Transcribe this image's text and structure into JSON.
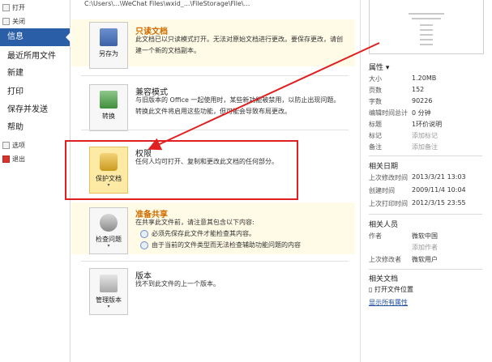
{
  "nav": {
    "small_top": [
      {
        "label": "打开",
        "icon": "folder-open-icon"
      },
      {
        "label": "关闭",
        "icon": "close-document-icon"
      }
    ],
    "items": [
      {
        "label": "信息",
        "active": true
      },
      {
        "label": "最近所用文件",
        "active": false
      },
      {
        "label": "新建",
        "active": false
      },
      {
        "label": "打印",
        "active": false
      },
      {
        "label": "保存并发送",
        "active": false
      },
      {
        "label": "帮助",
        "active": false
      }
    ],
    "small_bottom": [
      {
        "label": "选项",
        "icon": "options-icon"
      },
      {
        "label": "退出",
        "icon": "exit-icon"
      }
    ]
  },
  "path_text": "C:\\Users\\...\\WeChat Files\\wxid_...\\FileStorage\\File\\...",
  "sections": {
    "readonly": {
      "title": "只读文档",
      "desc": "此文档已以只读模式打开。无法对原始文档进行更改。要保存更改，请创建一个新的文档副本。",
      "button": "另存为"
    },
    "compat": {
      "title": "兼容模式",
      "desc": "与旧版本的 Office 一起使用时，某些新功能被禁用，以防止出现问题。转换此文件将启用这些功能，但可能会导致布局更改。",
      "button": "转换"
    },
    "permissions": {
      "title": "权限",
      "desc": "任何人均可打开、复制和更改此文档的任何部分。",
      "button": "保护文档"
    },
    "share": {
      "title": "准备共享",
      "desc": "在共享此文件前，请注意其包含以下内容:",
      "bullets": [
        "必须先保存此文件才能检查其内容。",
        "由于当前的文件类型而无法检查辅助功能问题的内容"
      ],
      "button": "检查问题"
    },
    "versions": {
      "title": "版本",
      "desc": "找不到此文件的上一个版本。",
      "button": "管理版本"
    }
  },
  "properties": {
    "header": "属性 ▾",
    "rows": [
      {
        "k": "大小",
        "v": "1.20MB",
        "muted": false
      },
      {
        "k": "页数",
        "v": "152",
        "muted": false
      },
      {
        "k": "字数",
        "v": "90226",
        "muted": false
      },
      {
        "k": "编辑时间总计",
        "v": "0 分钟",
        "muted": false
      },
      {
        "k": "标题",
        "v": "1环价说明",
        "muted": false
      },
      {
        "k": "标记",
        "v": "添加标记",
        "muted": true
      },
      {
        "k": "备注",
        "v": "添加备注",
        "muted": true
      }
    ]
  },
  "dates": {
    "header": "相关日期",
    "rows": [
      {
        "k": "上次修改时间",
        "v": "2013/3/21 13:03"
      },
      {
        "k": "创建时间",
        "v": "2009/11/4 10:04"
      },
      {
        "k": "上次打印时间",
        "v": "2012/3/15 23:55"
      }
    ]
  },
  "people": {
    "header": "相关人员",
    "rows": [
      {
        "k": "作者",
        "v": "微软中国",
        "muted": false
      },
      {
        "k": "",
        "v": "添加作者",
        "muted": true
      },
      {
        "k": "上次修改者",
        "v": "微软用户",
        "muted": false
      }
    ]
  },
  "related_docs": {
    "header": "相关文档",
    "open_location": "打开文件位置",
    "show_all": "显示所有属性"
  },
  "colors": {
    "accent": "#2a5fa8",
    "highlight_border": "#e02020",
    "warn_title": "#d26b00"
  }
}
